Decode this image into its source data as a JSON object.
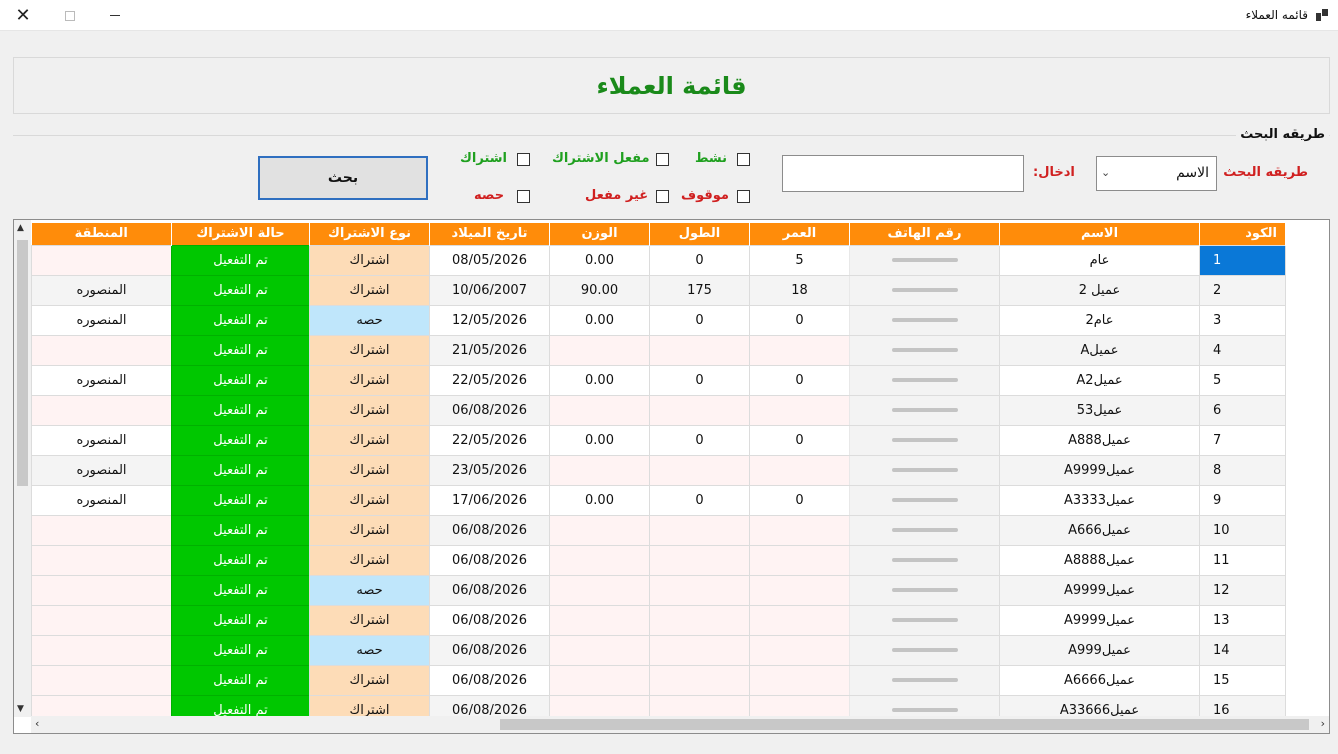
{
  "window": {
    "title": "قائمه العملاء",
    "close_glyph": "✕"
  },
  "header": {
    "title": "قائمة العملاء"
  },
  "search": {
    "group_title": "طريقه البحث",
    "method_label": "طريقه البحث",
    "method_value": "الاسم",
    "input_label": "ادخال:",
    "input_value": "",
    "checkboxes": {
      "active": "نشط",
      "sub_enabled": "مفعل الاشتراك",
      "subscription": "اشتراك",
      "stopped": "موقوف",
      "not_enabled": "غير مفعل",
      "session": "حصه"
    },
    "button_label": "بحث"
  },
  "grid": {
    "columns": [
      "الكود",
      "الاسم",
      "رقم الهاتف",
      "العمر",
      "الطول",
      "الوزن",
      "تاريخ الميلاد",
      "نوع الاشتراك",
      "حالة الاشتراك",
      "المنطقة"
    ],
    "rows": [
      {
        "code": "1",
        "name": "عام",
        "age": "5",
        "height": "0",
        "weight": "0.00",
        "birth": "08/05/2026",
        "type": "اشتراك",
        "status": "تم التفعيل",
        "region": ""
      },
      {
        "code": "2",
        "name": "عميل 2",
        "age": "18",
        "height": "175",
        "weight": "90.00",
        "birth": "10/06/2007",
        "type": "اشتراك",
        "status": "تم التفعيل",
        "region": "المنصوره"
      },
      {
        "code": "3",
        "name": "عام2",
        "age": "0",
        "height": "0",
        "weight": "0.00",
        "birth": "12/05/2026",
        "type": "حصه",
        "status": "تم التفعيل",
        "region": "المنصوره"
      },
      {
        "code": "4",
        "name": "عميلA",
        "age": "",
        "height": "",
        "weight": "",
        "birth": "21/05/2026",
        "type": "اشتراك",
        "status": "تم التفعيل",
        "region": ""
      },
      {
        "code": "5",
        "name": "عميلA2",
        "age": "0",
        "height": "0",
        "weight": "0.00",
        "birth": "22/05/2026",
        "type": "اشتراك",
        "status": "تم التفعيل",
        "region": "المنصوره"
      },
      {
        "code": "6",
        "name": "عميل53",
        "age": "",
        "height": "",
        "weight": "",
        "birth": "06/08/2026",
        "type": "اشتراك",
        "status": "تم التفعيل",
        "region": ""
      },
      {
        "code": "7",
        "name": "عميلA888",
        "age": "0",
        "height": "0",
        "weight": "0.00",
        "birth": "22/05/2026",
        "type": "اشتراك",
        "status": "تم التفعيل",
        "region": "المنصوره"
      },
      {
        "code": "8",
        "name": "عميلA9999",
        "age": "",
        "height": "",
        "weight": "",
        "birth": "23/05/2026",
        "type": "اشتراك",
        "status": "تم التفعيل",
        "region": "المنصوره"
      },
      {
        "code": "9",
        "name": "عميلA3333",
        "age": "0",
        "height": "0",
        "weight": "0.00",
        "birth": "17/06/2026",
        "type": "اشتراك",
        "status": "تم التفعيل",
        "region": "المنصوره"
      },
      {
        "code": "10",
        "name": "عميلA666",
        "age": "",
        "height": "",
        "weight": "",
        "birth": "06/08/2026",
        "type": "اشتراك",
        "status": "تم التفعيل",
        "region": ""
      },
      {
        "code": "11",
        "name": "عميلA8888",
        "age": "",
        "height": "",
        "weight": "",
        "birth": "06/08/2026",
        "type": "اشتراك",
        "status": "تم التفعيل",
        "region": ""
      },
      {
        "code": "12",
        "name": "عميلA9999",
        "age": "",
        "height": "",
        "weight": "",
        "birth": "06/08/2026",
        "type": "حصه",
        "status": "تم التفعيل",
        "region": ""
      },
      {
        "code": "13",
        "name": "عميلA9999",
        "age": "",
        "height": "",
        "weight": "",
        "birth": "06/08/2026",
        "type": "اشتراك",
        "status": "تم التفعيل",
        "region": ""
      },
      {
        "code": "14",
        "name": "عميلA999",
        "age": "",
        "height": "",
        "weight": "",
        "birth": "06/08/2026",
        "type": "حصه",
        "status": "تم التفعيل",
        "region": ""
      },
      {
        "code": "15",
        "name": "عميلA6666",
        "age": "",
        "height": "",
        "weight": "",
        "birth": "06/08/2026",
        "type": "اشتراك",
        "status": "تم التفعيل",
        "region": ""
      },
      {
        "code": "16",
        "name": "عميلA33666",
        "age": "",
        "height": "",
        "weight": "",
        "birth": "06/08/2026",
        "type": "اشتراك",
        "status": "تم التفعيل",
        "region": ""
      }
    ],
    "session_type_value": "حصه"
  },
  "colors": {
    "header_orange": "#ff8c0a",
    "status_green": "#00c700",
    "title_green": "#1a8a1a",
    "label_red": "#d02020",
    "label_green": "#1fa01f",
    "subscription_bg": "#fddcb7",
    "session_bg": "#bfe6fb",
    "selection_blue": "#0a78d7"
  },
  "icons": {
    "close": "close-icon",
    "maximize": "maximize-icon",
    "minimize": "minimize-icon",
    "app": "app-icon",
    "dropdown": "chevron-down-icon"
  }
}
